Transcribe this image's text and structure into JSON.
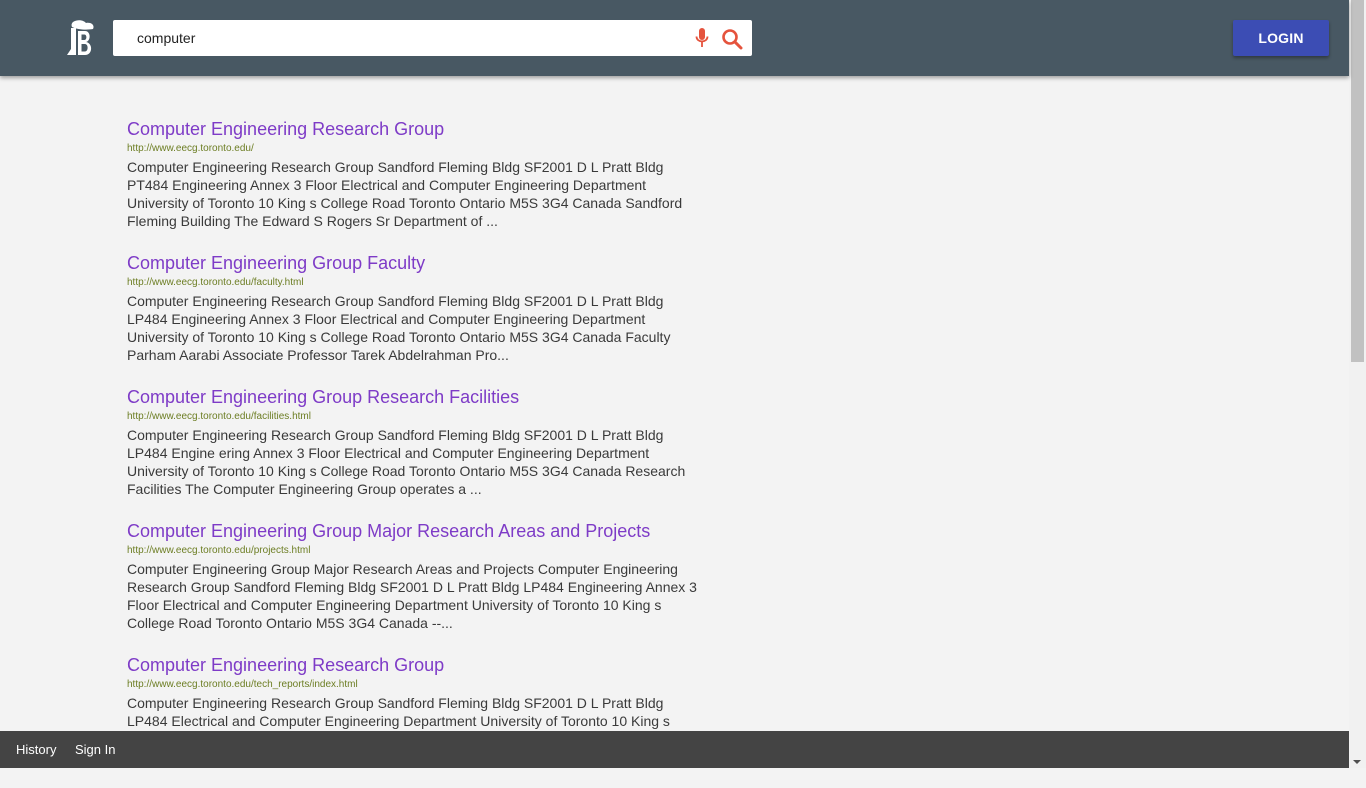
{
  "header": {
    "logo_icon": "tree-b-logo-icon",
    "search": {
      "value": "computer",
      "placeholder": "",
      "mic_icon": "microphone-icon",
      "search_icon": "search-icon"
    },
    "login_label": "LOGIN"
  },
  "colors": {
    "header_bg": "#485863",
    "login_bg": "#3c4db4",
    "title_link": "#7e3bc7",
    "url_text": "#6d7e24",
    "footer_bg": "#444444"
  },
  "results": [
    {
      "title": "Computer Engineering Research Group",
      "url": "http://www.eecg.toronto.edu/",
      "snippet": "Computer Engineering Research Group Sandford Fleming Bldg SF2001 D L Pratt Bldg PT484 Engineering Annex 3 Floor Electrical and Computer Engineering Department University of Toronto 10 King s College Road Toronto Ontario M5S 3G4 Canada Sandford Fleming Building The Edward S Rogers Sr Department of ..."
    },
    {
      "title": "Computer Engineering Group Faculty",
      "url": "http://www.eecg.toronto.edu/faculty.html",
      "snippet": "Computer Engineering Research Group Sandford Fleming Bldg SF2001 D L Pratt Bldg LP484 Engineering Annex 3 Floor Electrical and Computer Engineering Department University of Toronto 10 King s College Road Toronto Ontario M5S 3G4 Canada Faculty Parham Aarabi Associate Professor Tarek Abdelrahman Pro..."
    },
    {
      "title": "Computer Engineering Group Research Facilities",
      "url": "http://www.eecg.toronto.edu/facilities.html",
      "snippet": "Computer Engineering Research Group Sandford Fleming Bldg SF2001 D L Pratt Bldg LP484 Engine ering Annex 3 Floor Electrical and Computer Engineering Department University of Toronto 10 King s College Road Toronto Ontario M5S 3G4 Canada Research Facilities The Computer Engineering Group operates a ..."
    },
    {
      "title": "Computer Engineering Group Major Research Areas and Projects",
      "url": "http://www.eecg.toronto.edu/projects.html",
      "snippet": "Computer Engineering Group Major Research Areas and Projects Computer Engineering Research Group Sandford Fleming Bldg SF2001 D L Pratt Bldg LP484 Engineering Annex 3 Floor Electrical and Computer Engineering Department University of Toronto 10 King s College Road Toronto Ontario M5S 3G4 Canada --..."
    },
    {
      "title": "Computer Engineering Research Group",
      "url": "http://www.eecg.toronto.edu/tech_reports/index.html",
      "snippet": "Computer Engineering Research Group Sandford Fleming Bldg SF2001 D L Pratt Bldg LP484 Electrical and Computer Engineering Department University of Toronto 10 King s College Road Toronto Ontario M5S 3G4 Canada Technical Reports Here you will find technical reports published by members of the Comput..."
    }
  ],
  "footer": {
    "history_label": "History",
    "signin_label": "Sign In"
  }
}
